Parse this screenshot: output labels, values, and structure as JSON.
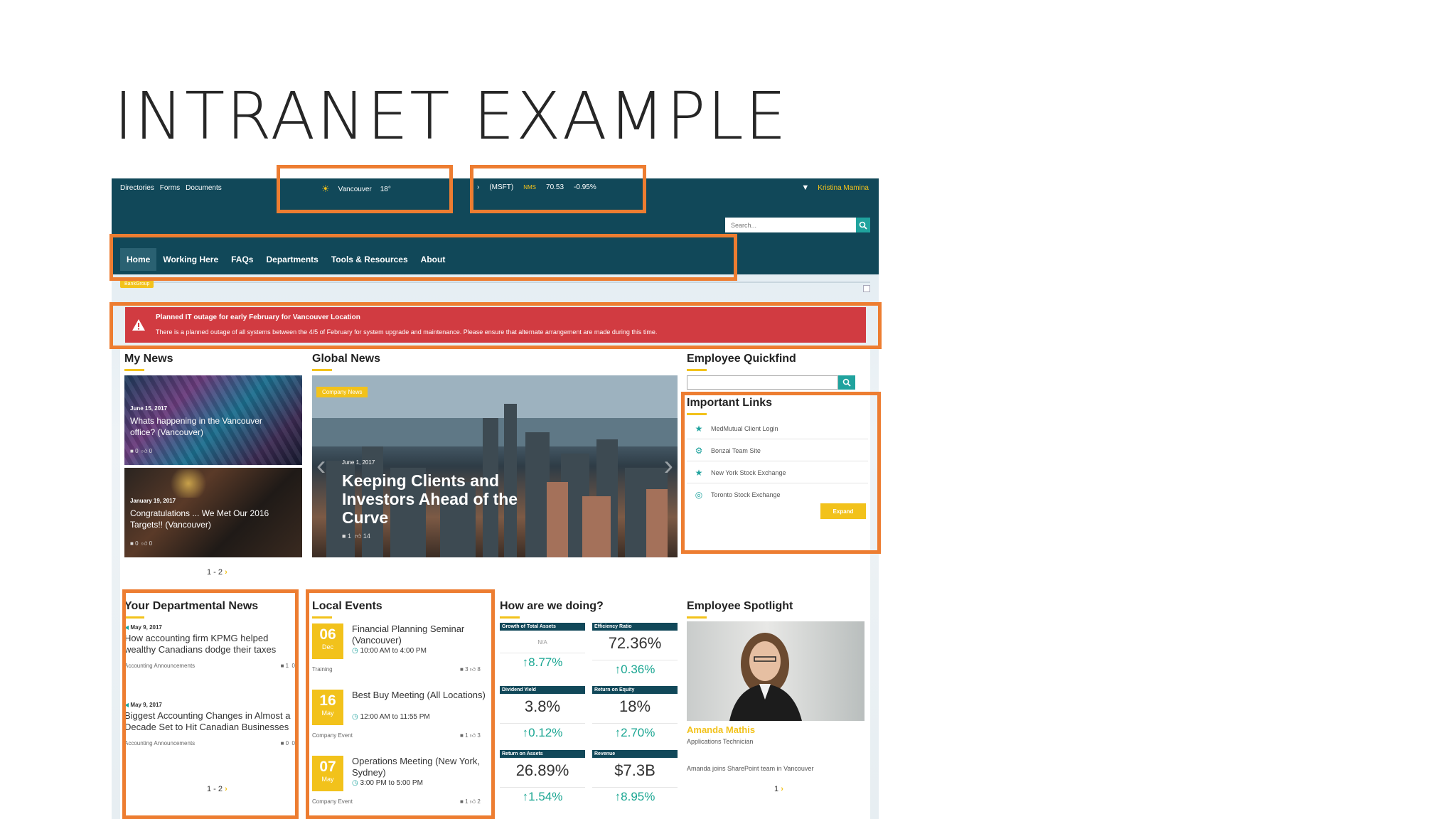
{
  "slide": {
    "title": "INTRANET EXAMPLE"
  },
  "topbar": {
    "utility_links": [
      "Directories",
      "Forms",
      "Documents"
    ],
    "weather": {
      "city": "Vancouver",
      "temp": "18°"
    },
    "stock": {
      "ticker": "(MSFT)",
      "exchange": "NMS",
      "price": "70.53",
      "change": "-0.95%"
    },
    "user_name": "Kristina Mamina",
    "search_placeholder": "Search..."
  },
  "nav": {
    "items": [
      "Home",
      "Working Here",
      "FAQs",
      "Departments",
      "Tools & Resources",
      "About"
    ],
    "active": "Home"
  },
  "breadcrumb": {
    "tag": "BankGroup"
  },
  "alert": {
    "title": "Planned IT outage for early February for Vancouver Location",
    "body": "There is a planned outage of all systems between the 4/5 of February for system upgrade and maintenance. Please ensure that alternate arrangement are made during this time."
  },
  "my_news": {
    "title": "My News",
    "items": [
      {
        "date": "June 15, 2017",
        "title": "Whats happening in the Vancouver office? (Vancouver)",
        "comments": "0",
        "likes": "0"
      },
      {
        "date": "January 19, 2017",
        "title": "Congratulations ... We Met Our 2016 Targets!! (Vancouver)",
        "comments": "0",
        "likes": "0"
      }
    ],
    "pager": "1 - 2"
  },
  "global_news": {
    "title": "Global News",
    "tag": "Company News",
    "date": "June 1, 2017",
    "headline": "Keeping Clients and Investors Ahead of the Curve",
    "comments": "1",
    "likes": "14"
  },
  "quickfind": {
    "title": "Employee Quickfind"
  },
  "important_links": {
    "title": "Important Links",
    "items": [
      {
        "label": "MedMutual Client Login",
        "icon": "star-icon"
      },
      {
        "label": "Bonzai Team Site",
        "icon": "gear-icon"
      },
      {
        "label": "New York Stock Exchange",
        "icon": "star-icon"
      },
      {
        "label": "Toronto Stock Exchange",
        "icon": "globe-icon"
      }
    ],
    "expand_label": "Expand"
  },
  "departmental_news": {
    "title": "Your Departmental News",
    "items": [
      {
        "date": "May 9, 2017",
        "title": "How accounting firm KPMG helped wealthy Canadians dodge their taxes",
        "category": "Accounting Announcements",
        "comments": "1",
        "likes": "0"
      },
      {
        "date": "May 9, 2017",
        "title": "Biggest Accounting Changes in Almost a Decade Set to Hit Canadian Businesses",
        "category": "Accounting Announcements",
        "comments": "0",
        "likes": "0"
      }
    ],
    "pager": "1 - 2"
  },
  "local_events": {
    "title": "Local Events",
    "items": [
      {
        "day": "06",
        "month": "Dec",
        "title": "Financial Planning Seminar (Vancouver)",
        "time": "10:00 AM to 4:00 PM",
        "type": "Training",
        "comments": "3",
        "likes": "8"
      },
      {
        "day": "16",
        "month": "May",
        "title": "Best Buy Meeting (All Locations)",
        "time": "12:00 AM to 11:55 PM",
        "type": "Company Event",
        "comments": "1",
        "likes": "3"
      },
      {
        "day": "07",
        "month": "May",
        "title": "Operations Meeting (New York, Sydney)",
        "time": "3:00 PM to 5:00 PM",
        "type": "Company Event",
        "comments": "1",
        "likes": "2"
      }
    ]
  },
  "performance": {
    "title": "How are we doing?",
    "metrics": [
      {
        "label": "Growth of Total Assets",
        "value": "N/A",
        "change": "8.77%"
      },
      {
        "label": "Efficiency Ratio",
        "value": "72.36%",
        "change": "0.36%"
      },
      {
        "label": "Dividend Yield",
        "value": "3.8%",
        "change": "0.12%"
      },
      {
        "label": "Return on Equity",
        "value": "18%",
        "change": "2.70%"
      },
      {
        "label": "Return on Assets",
        "value": "26.89%",
        "change": "1.54%"
      },
      {
        "label": "Revenue",
        "value": "$7.3B",
        "change": "8.95%"
      }
    ]
  },
  "spotlight": {
    "title": "Employee Spotlight",
    "name": "Amanda Mathis",
    "role": "Applications Technician",
    "description": "Amanda joins SharePoint team in Vancouver",
    "pager": "1"
  },
  "colors": {
    "navy": "#114859",
    "accent": "#f2c21b",
    "alert": "#d13b41",
    "teal": "#20a39e",
    "highlight": "#ed7d31"
  }
}
